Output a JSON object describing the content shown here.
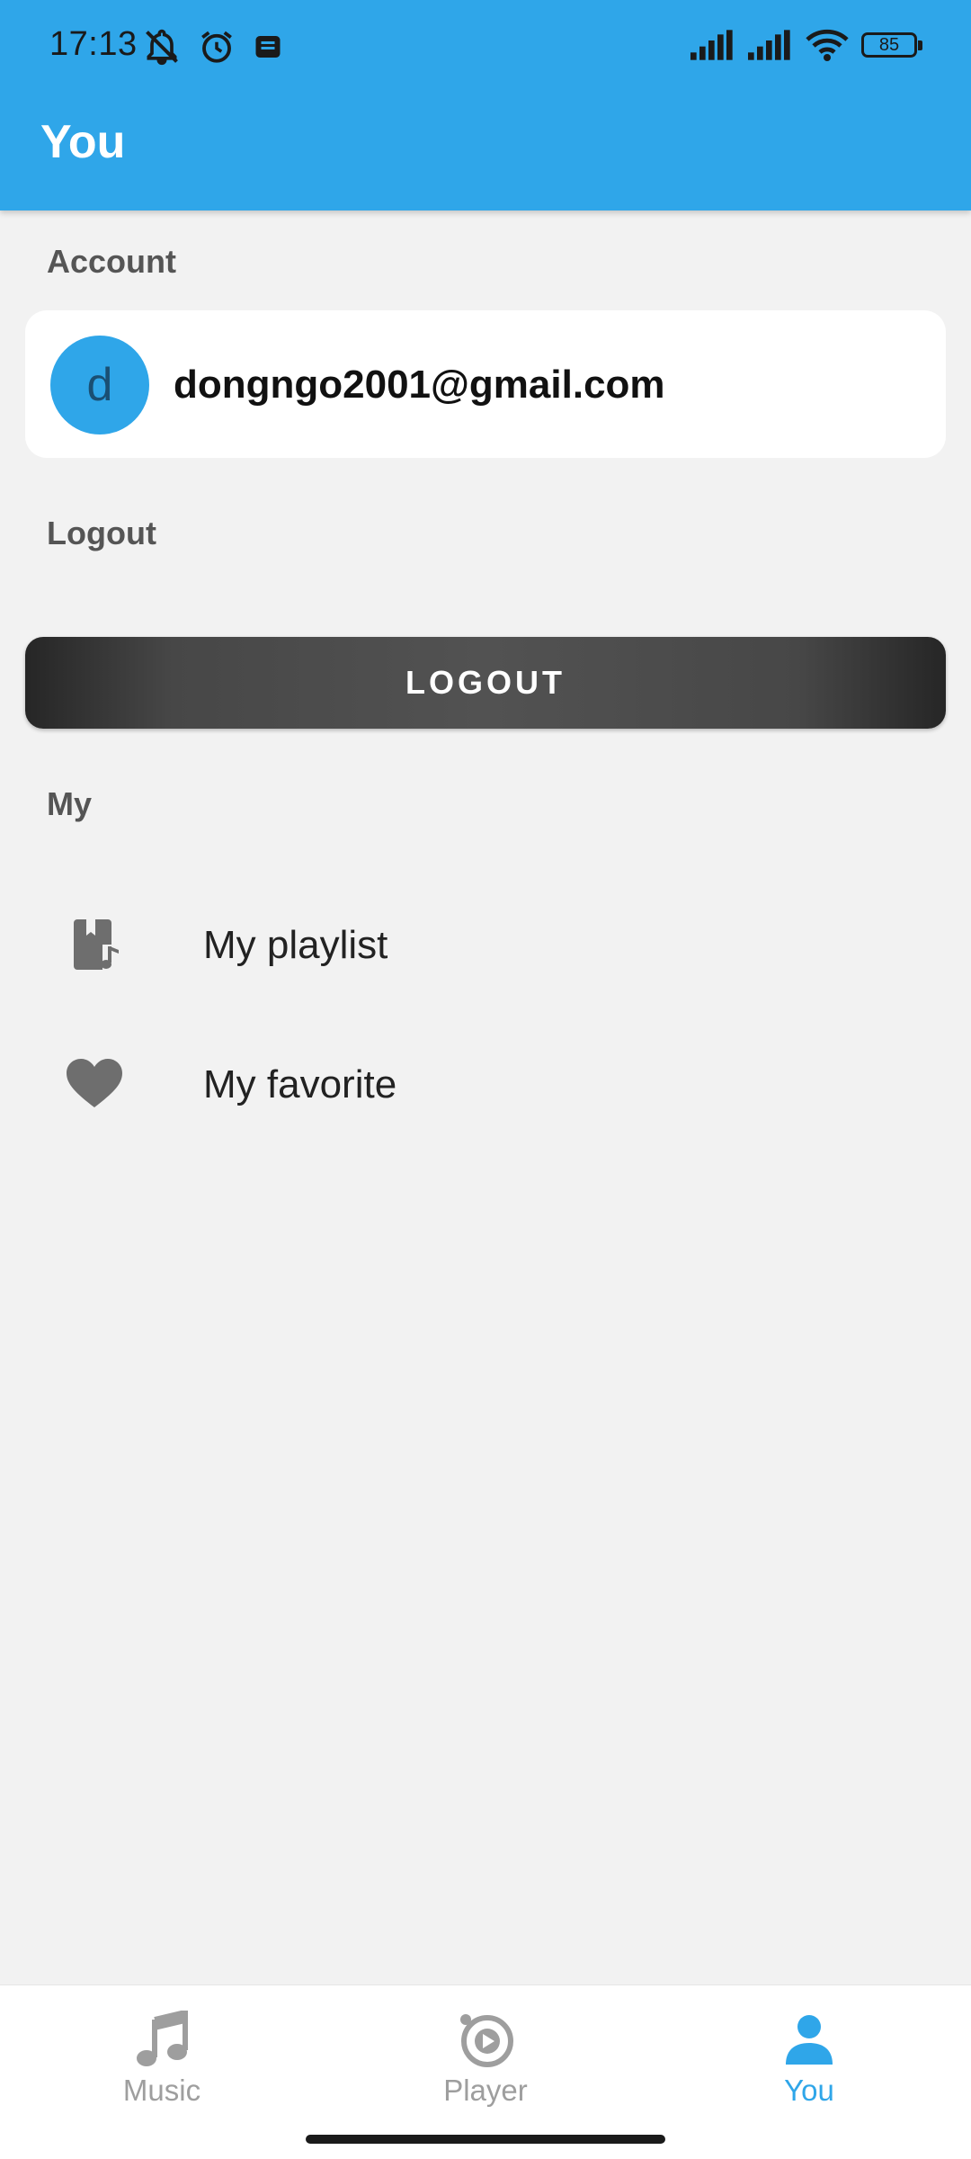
{
  "status_bar": {
    "time": "17:13",
    "battery": "85"
  },
  "header": {
    "title": "You"
  },
  "account": {
    "section_label": "Account",
    "avatar_letter": "d",
    "email": "dongngo2001@gmail.com"
  },
  "logout": {
    "section_label": "Logout",
    "button_label": "LOGOUT"
  },
  "my": {
    "section_label": "My",
    "items": [
      {
        "label": "My playlist",
        "icon": "playlist-icon"
      },
      {
        "label": "My favorite",
        "icon": "heart-icon"
      }
    ]
  },
  "bottom_nav": {
    "items": [
      {
        "label": "Music",
        "icon": "music-note-icon",
        "active": false
      },
      {
        "label": "Player",
        "icon": "player-icon",
        "active": false
      },
      {
        "label": "You",
        "icon": "person-icon",
        "active": true
      }
    ]
  },
  "colors": {
    "primary": "#2fa6e9",
    "background": "#f2f2f2",
    "inactive": "#9e9e9e"
  }
}
